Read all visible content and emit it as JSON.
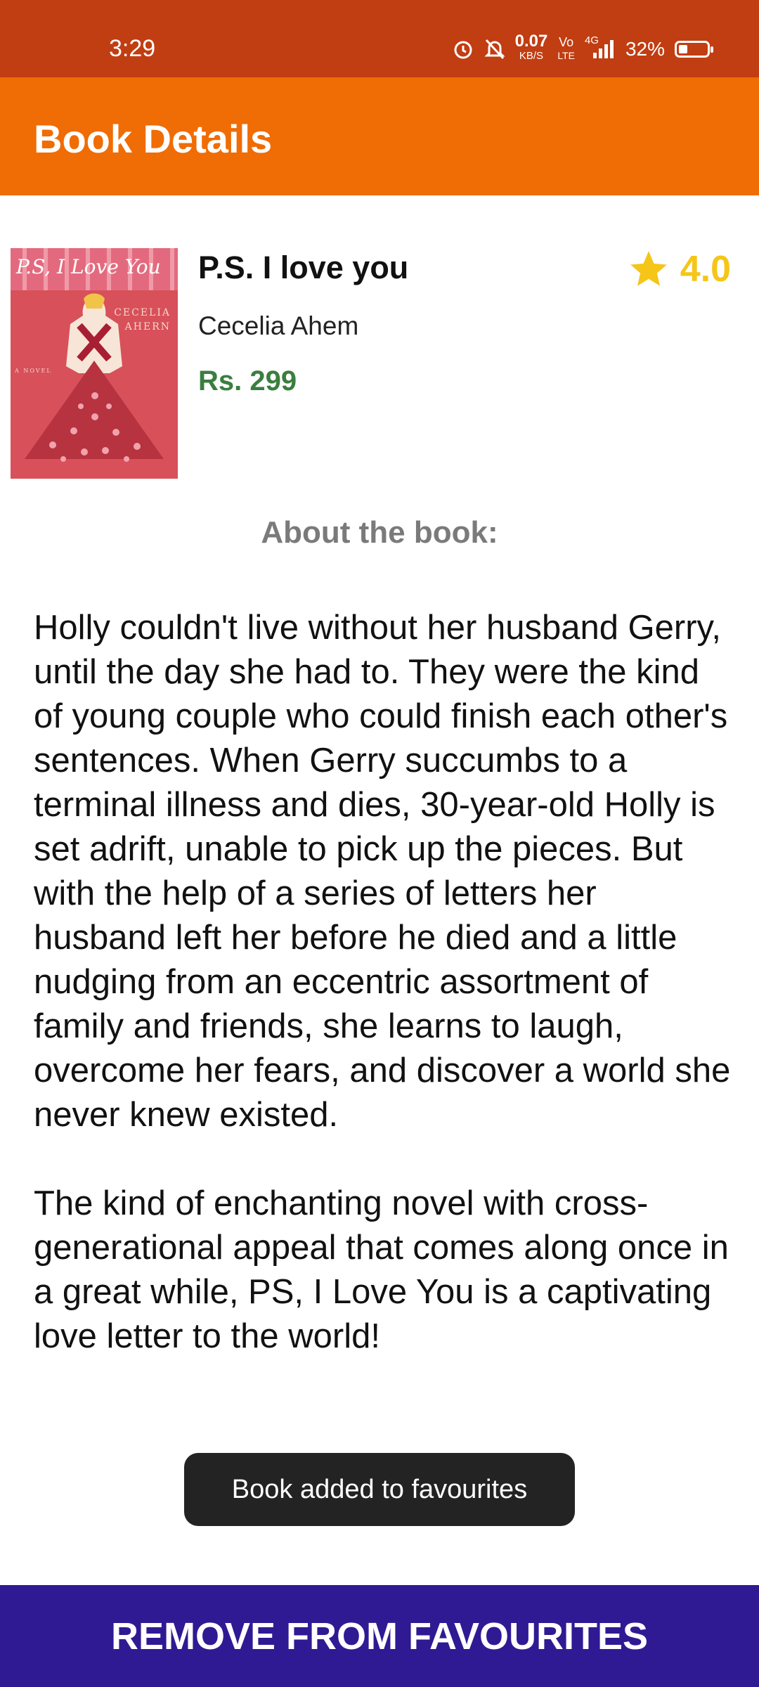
{
  "status_bar": {
    "time": "3:29",
    "net_speed_value": "0.07",
    "net_speed_unit": "KB/S",
    "volte_top": "Vo",
    "volte_bottom": "LTE",
    "network": "4G",
    "battery": "32%",
    "battery_level": 0.32
  },
  "app_bar": {
    "title": "Book Details"
  },
  "book": {
    "title": "P.S. I love you",
    "author": "Cecelia Ahem",
    "price": "Rs. 299",
    "rating": "4.0",
    "cover": {
      "title": "P.S, I Love You",
      "author_line1": "Cecelia",
      "author_line2": "Ahern",
      "tag": "A NOVEL"
    }
  },
  "about": {
    "heading": "About the book:",
    "description": "Holly couldn't live without her husband Gerry, until the day she had to. They were the kind of young couple who could finish each other's sentences. When Gerry succumbs to a terminal illness and dies, 30-year-old Holly is set adrift, unable to pick up the pieces. But with the help of a series of letters her husband left her before he died and a little nudging from an eccentric assortment of family and friends, she learns to laugh, overcome her fears, and discover a world she never knew existed.\n\nThe kind of enchanting novel with cross-generational appeal that comes along once in a great while, PS, I Love You is a captivating love letter to the world!"
  },
  "toast": {
    "message": "Book added to favourites"
  },
  "actions": {
    "remove_favourites_label": "REMOVE FROM FAVOURITES"
  },
  "colors": {
    "status_bar": "#c13d12",
    "app_bar": "#f06c04",
    "price": "#3a7e3f",
    "rating": "#f5c518",
    "button": "#2f1a94"
  },
  "icons": [
    "alarm-icon",
    "mute-icon",
    "signal-icon",
    "battery-icon",
    "star-icon"
  ]
}
